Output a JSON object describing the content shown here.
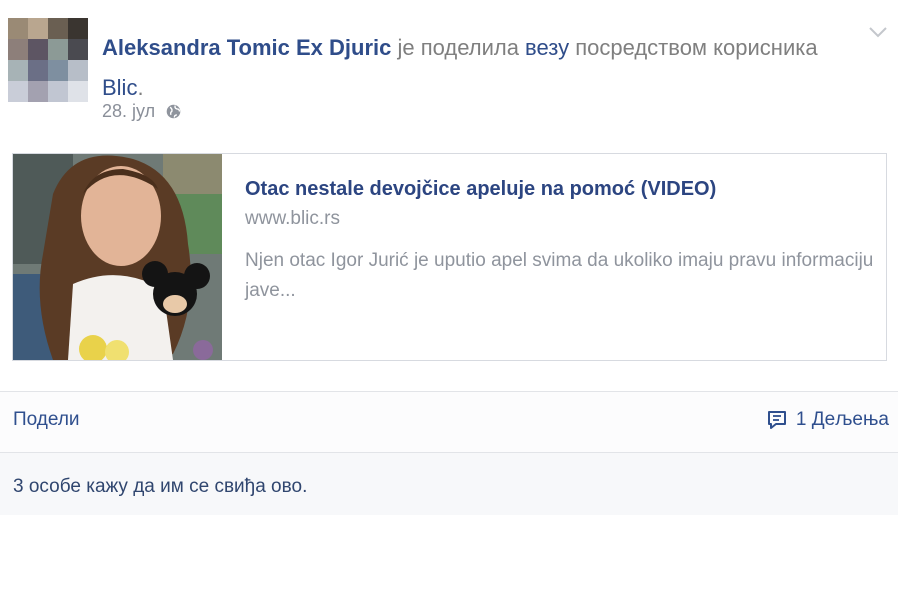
{
  "post": {
    "author": "Aleksandra Tomic Ex Djuric",
    "shared_text": " је поделила ",
    "link_word": "везу",
    "via_text": " посредством корисника ",
    "via_page": "Blic",
    "period": ".",
    "date": "28. јул",
    "privacy_icon": "globe-icon",
    "menu_icon": "chevron-down-icon"
  },
  "link_card": {
    "title": "Otac nestale devojčice apeluje na pomoć (VIDEO)",
    "domain": "www.blic.rs",
    "description": "Njen otac Igor Jurić je uputio apel svima da ukoliko imaju pravu informaciju jave..."
  },
  "actions": {
    "share_label": "Подели",
    "shares_icon": "shares-icon",
    "shares_count": "1 Дељења"
  },
  "likes": {
    "text": "3 особе кажу да им се свиђа ово."
  },
  "colors": {
    "link_blue": "#2f4d8a",
    "meta_grey": "#8a8f99",
    "border": "#d7dae0"
  }
}
